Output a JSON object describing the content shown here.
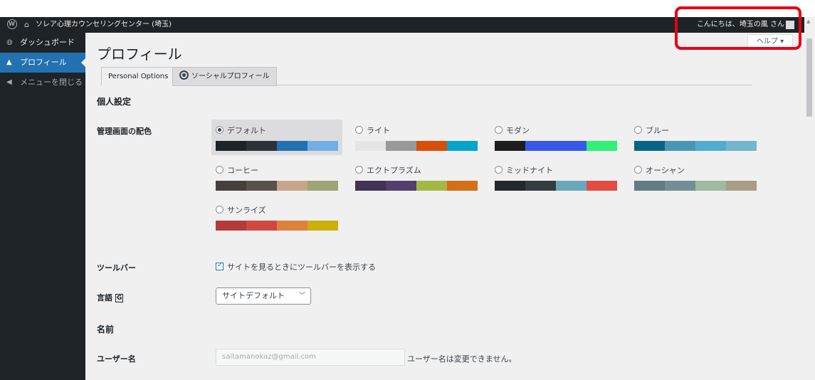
{
  "adminbar": {
    "site_name": "ソレア心理カウンセリングセンター (埼玉)",
    "greeting": "こんにちは、埼玉の風 さん"
  },
  "sidebar": {
    "items": [
      {
        "label": "ダッシュボード",
        "icon": "dashboard-icon"
      },
      {
        "label": "プロフィール",
        "icon": "user-icon"
      },
      {
        "label": "メニューを閉じる",
        "icon": "collapse-icon"
      }
    ]
  },
  "header": {
    "title": "プロフィール",
    "help_label": "ヘルプ ▾"
  },
  "tabs": [
    {
      "label": "Personal Options",
      "active": true
    },
    {
      "label": "ソーシャルプロフィール",
      "active": false,
      "icon": "gear-icon"
    }
  ],
  "personal": {
    "heading": "個人設定",
    "color_label": "管理画面の配色",
    "schemes": [
      {
        "name": "デフォルト",
        "selected": true,
        "colors": [
          "#1d2327",
          "#2c3338",
          "#2271b1",
          "#72aee6"
        ]
      },
      {
        "name": "ライト",
        "selected": false,
        "colors": [
          "#e5e5e5",
          "#999999",
          "#d64e07",
          "#04a4cc"
        ]
      },
      {
        "name": "モダン",
        "selected": false,
        "colors": [
          "#1e1e1e",
          "#3858e9",
          "#3858e9",
          "#33f078"
        ]
      },
      {
        "name": "ブルー",
        "selected": false,
        "colors": [
          "#096484",
          "#4796b3",
          "#52accc",
          "#74b6ce"
        ]
      },
      {
        "name": "コーヒー",
        "selected": false,
        "colors": [
          "#46403c",
          "#59524c",
          "#c7a589",
          "#9ea476"
        ]
      },
      {
        "name": "エクトプラズム",
        "selected": false,
        "colors": [
          "#413256",
          "#523f6d",
          "#a3b745",
          "#d46f15"
        ]
      },
      {
        "name": "ミッドナイト",
        "selected": false,
        "colors": [
          "#25282b",
          "#363b3f",
          "#69a8bb",
          "#e14d43"
        ]
      },
      {
        "name": "オーシャン",
        "selected": false,
        "colors": [
          "#627c83",
          "#738e96",
          "#9ebaa0",
          "#aa9d88"
        ]
      },
      {
        "name": "サンライズ",
        "selected": false,
        "colors": [
          "#b43c38",
          "#cf4944",
          "#dd823b",
          "#ccaf0b"
        ]
      }
    ],
    "toolbar_label": "ツールバー",
    "toolbar_checkbox": "サイトを見るときにツールバーを表示する",
    "language_label": "言語",
    "language_icon": "translate-icon",
    "language_value": "サイトデフォルト"
  },
  "name_section": {
    "heading": "名前",
    "username_label": "ユーザー名",
    "username_value": "saitamanokaz@gmail.com",
    "username_desc": "ユーザー名は変更できません。"
  }
}
